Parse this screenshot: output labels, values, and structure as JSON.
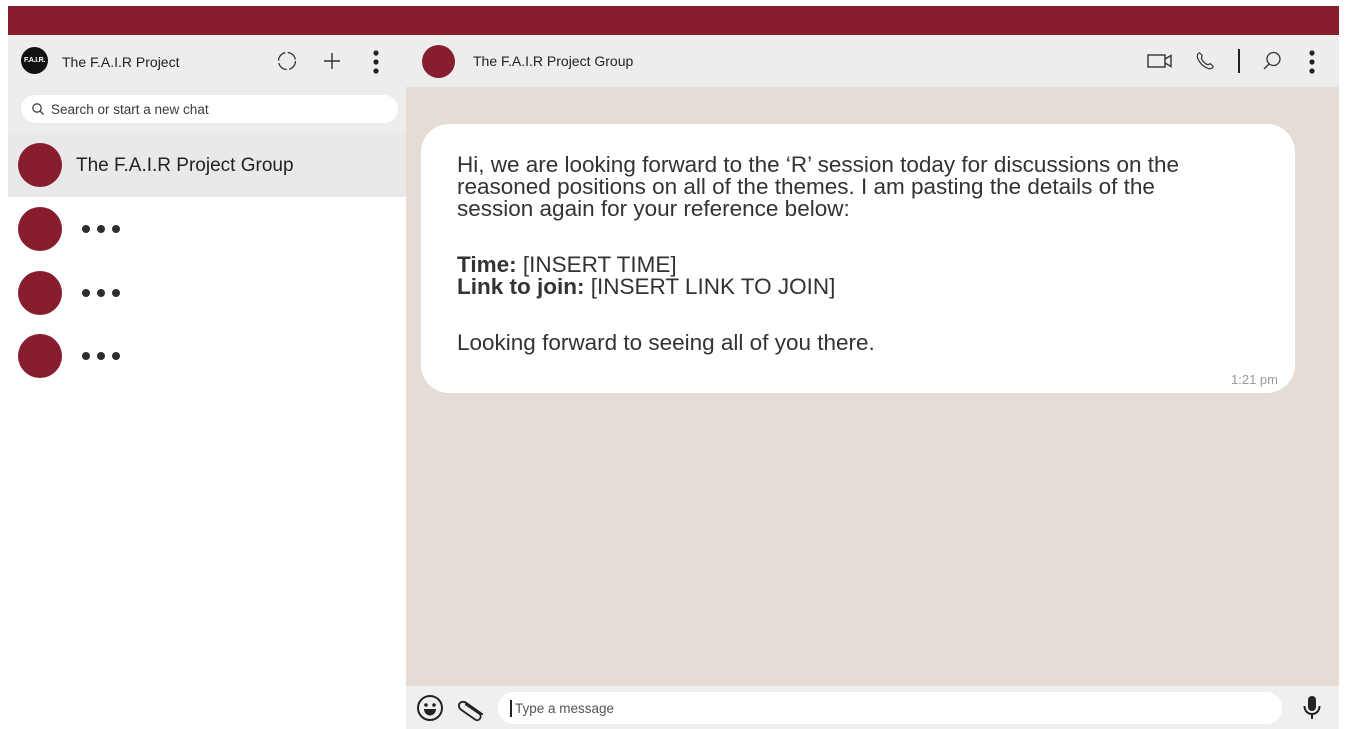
{
  "colors": {
    "accent": "#861e2d",
    "panel": "#ededed",
    "chat_bg": "#e5ddd5"
  },
  "sidebar": {
    "logo_text": "F.A.I.R.",
    "title": "The F.A.I.R Project",
    "icons": [
      "status-icon",
      "new-chat-icon",
      "menu-icon"
    ],
    "search": {
      "placeholder": "Search or start a new chat"
    },
    "chats": [
      {
        "name": "The F.A.I.R Project Group",
        "active": true
      },
      {
        "name": "•••",
        "active": false
      },
      {
        "name": "•••",
        "active": false
      },
      {
        "name": "•••",
        "active": false
      }
    ]
  },
  "conversation": {
    "title": "The F.A.I.R Project Group",
    "icons": [
      "video-call-icon",
      "voice-call-icon",
      "search-icon",
      "menu-icon"
    ],
    "message": {
      "line1": "Hi, we are looking forward to the ‘R’ session today for discussions on the",
      "line2": "reasoned positions on all of the themes. I am pasting the details of the",
      "line3": "session again for your reference below:",
      "time_label": "Time:",
      "time_value": " [INSERT TIME]",
      "link_label": "Link to join:",
      "link_value": " [INSERT LINK TO JOIN]",
      "closing": "Looking forward to seeing all of you there.",
      "timestamp": "1:21 pm"
    },
    "composer": {
      "placeholder": "Type a message",
      "icons": [
        "emoji-icon",
        "attach-icon",
        "microphone-icon"
      ]
    }
  }
}
